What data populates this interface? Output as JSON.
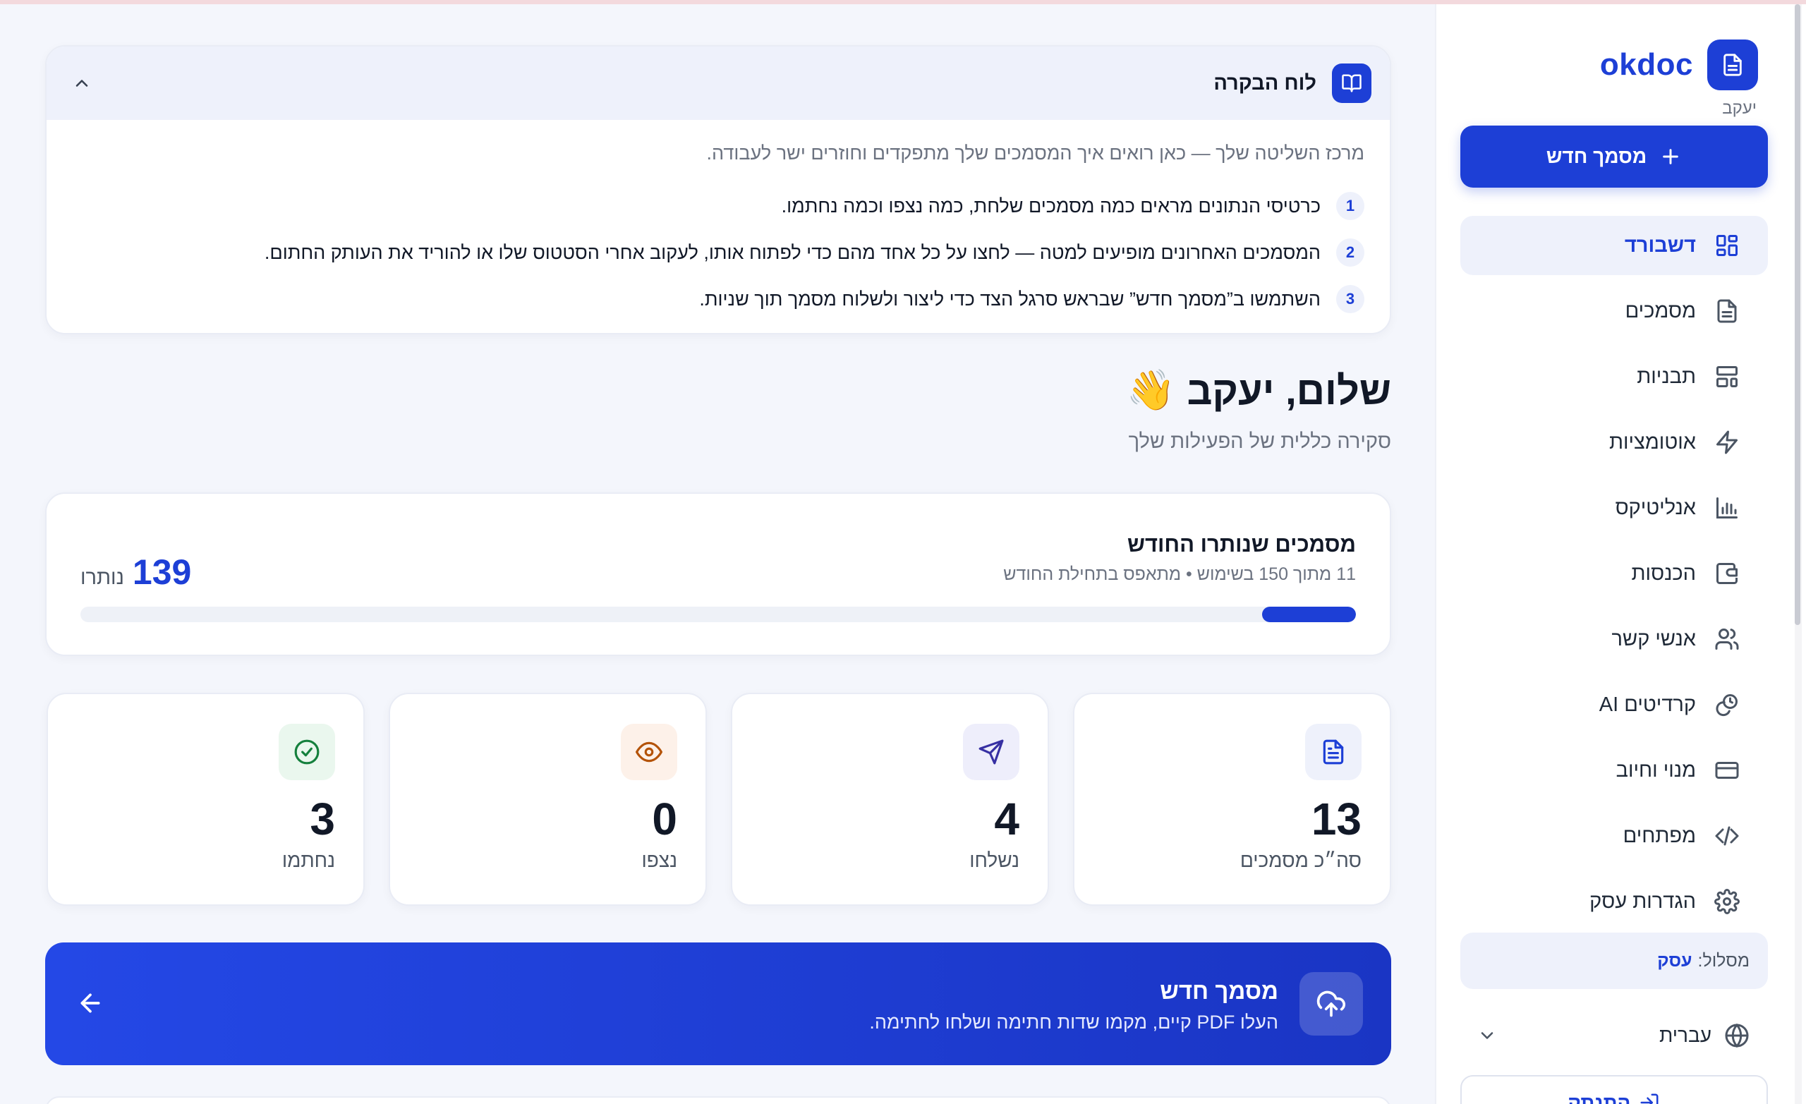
{
  "sidebar": {
    "brand": "okdoc",
    "user_name": "יעקב",
    "new_doc_label": "מסמך חדש",
    "items": [
      {
        "label": "דשבורד",
        "icon": "dashboard-icon"
      },
      {
        "label": "מסמכים",
        "icon": "document-icon"
      },
      {
        "label": "תבניות",
        "icon": "templates-icon"
      },
      {
        "label": "אוטומציות",
        "icon": "lightning-icon"
      },
      {
        "label": "אנליטיקס",
        "icon": "chart-icon"
      },
      {
        "label": "הכנסות",
        "icon": "wallet-icon"
      },
      {
        "label": "אנשי קשר",
        "icon": "users-icon"
      },
      {
        "label": "קרדיטים AI",
        "icon": "coins-icon"
      },
      {
        "label": "מנוי וחיוב",
        "icon": "credit-card-icon"
      },
      {
        "label": "מפתחים",
        "icon": "code-icon"
      },
      {
        "label": "הגדרות עסק",
        "icon": "gear-icon"
      }
    ],
    "plan_label": "מסלול:",
    "plan_value": "עסק",
    "language": "עברית",
    "logout_label": "התנתק"
  },
  "guide": {
    "title": "לוח הבקרה",
    "intro": "מרכז השליטה שלך — כאן רואים איך המסמכים שלך מתפקדים וחוזרים ישר לעבודה.",
    "steps": [
      {
        "num": "1",
        "text": "כרטיסי הנתונים מראים כמה מסמכים שלחת, כמה נצפו וכמה נחתמו."
      },
      {
        "num": "2",
        "text": "המסמכים האחרונים מופיעים למטה — לחצו על כל אחד מהם כדי לפתוח אותו, לעקוב אחרי הסטטוס שלו או להוריד את העותק החתום."
      },
      {
        "num": "3",
        "text": "השתמשו ב”מסמך חדש” שבראש סרגל הצד כדי ליצור ולשלוח מסמך תוך שניות."
      }
    ]
  },
  "greeting": {
    "title": "שלום, יעקב",
    "emoji": "👋",
    "subtitle": "סקירה כללית של הפעילות שלך"
  },
  "usage": {
    "title": "מסמכים שנותרו החודש",
    "subtitle": "11 מתוך 150 בשימוש • מתאפס בתחילת החודש",
    "remaining": "139",
    "remaining_label": "נותרו",
    "used": 11,
    "total": 150
  },
  "stats": [
    {
      "value": "13",
      "label": "סה״כ מסמכים",
      "icon": "document-icon",
      "bg": "#eef1fb",
      "color": "#1d3fd6"
    },
    {
      "value": "4",
      "label": "נשלחו",
      "icon": "send-icon",
      "bg": "#eeeefb",
      "color": "#3730a3"
    },
    {
      "value": "0",
      "label": "נצפו",
      "icon": "eye-icon",
      "bg": "#fdf1e9",
      "color": "#b45309"
    },
    {
      "value": "3",
      "label": "נחתמו",
      "icon": "check-circle-icon",
      "bg": "#eaf7ee",
      "color": "#15803d"
    }
  ],
  "cta": {
    "title": "מסמך חדש",
    "subtitle": "העלו PDF קיים, מקמו שדות חתימה ושלחו לחתימה."
  },
  "colors": {
    "accent": "#1d3fd6",
    "background": "#f4f6fc"
  }
}
